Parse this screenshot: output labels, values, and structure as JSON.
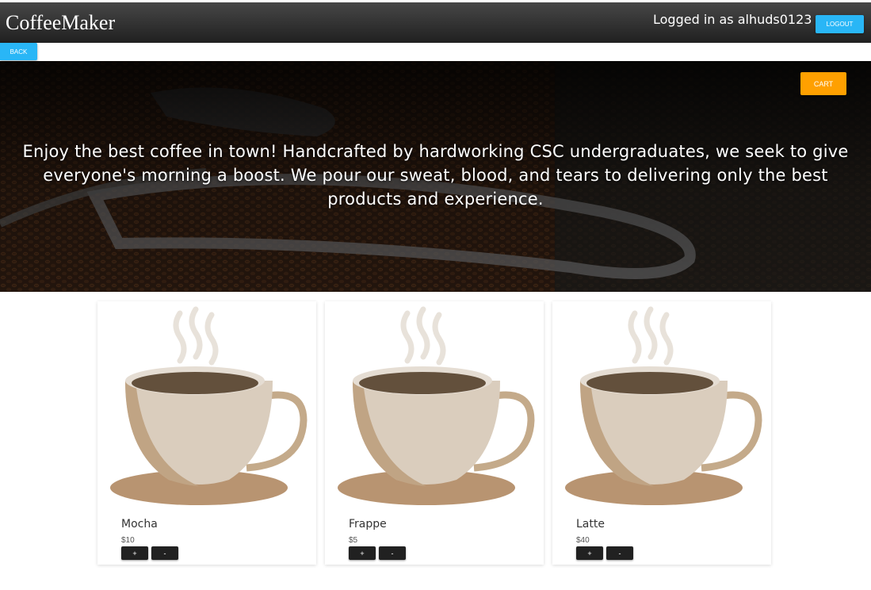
{
  "header": {
    "brand": "CoffeeMaker",
    "logged_in_text": "Logged in as alhuds0123",
    "logout_label": "LOGOUT"
  },
  "nav": {
    "back_label": "BACK"
  },
  "hero": {
    "cart_label": "CART",
    "tagline": "Enjoy the best coffee in town! Handcrafted by hardworking CSC undergraduates, we seek to give everyone's morning a boost. We pour our sweat, blood, and tears to delivering only the best products and experience."
  },
  "products": [
    {
      "name": "Mocha",
      "price": "$10",
      "plus_label": "+",
      "minus_label": "-"
    },
    {
      "name": "Frappe",
      "price": "$5",
      "plus_label": "+",
      "minus_label": "-"
    },
    {
      "name": "Latte",
      "price": "$40",
      "plus_label": "+",
      "minus_label": "-"
    }
  ],
  "colors": {
    "accent_blue": "#29b6f6",
    "cart_orange": "#ffa000",
    "qty_button": "#212121"
  }
}
